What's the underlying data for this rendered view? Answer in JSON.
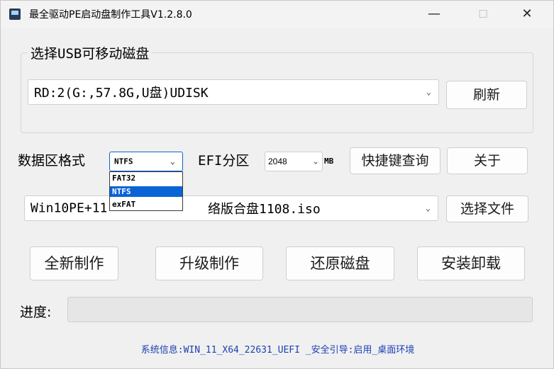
{
  "window": {
    "title": "最全驱动PE启动盘制作工具V1.2.8.0",
    "minimize_glyph": "—",
    "maximize_glyph": "☐",
    "close_glyph": "✕"
  },
  "usb_group": {
    "legend": "选择USB可移动磁盘",
    "selected_disk": "RD:2(G:,57.8G,U盘)UDISK",
    "refresh_label": "刷新"
  },
  "format_row": {
    "data_format_label": "数据区格式",
    "data_format_value": "NTFS",
    "format_options": [
      "FAT32",
      "NTFS",
      "exFAT"
    ],
    "format_selected_index": 1,
    "efi_label": "EFI分区",
    "efi_size": "2048",
    "efi_unit": "MB",
    "shortcut_button": "快捷键查询",
    "about_button": "关于"
  },
  "iso_row": {
    "iso_visible_left": "Win10PE+11",
    "iso_visible_right": "络版合盘1108.iso",
    "choose_file_button": "选择文件"
  },
  "actions": {
    "new_make": "全新制作",
    "upgrade_make": "升级制作",
    "restore_disk": "还原磁盘",
    "install_uninstall": "安装卸载"
  },
  "progress": {
    "label": "进度:",
    "value": 0
  },
  "status_bar": {
    "text": "系统信息:WIN_11_X64_22631_UEFI _安全引导:启用_桌面环境"
  },
  "icons": {
    "app": "app-usb-icon",
    "chevron": "chevron-down-icon"
  }
}
